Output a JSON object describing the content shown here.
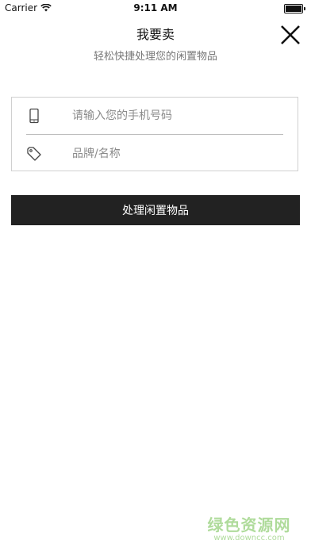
{
  "status_bar": {
    "carrier": "Carrier",
    "time": "9:11 AM"
  },
  "header": {
    "title": "我要卖",
    "subtitle": "轻松快捷处理您的闲置物品",
    "close_icon": "close-x-icon"
  },
  "form": {
    "phone": {
      "placeholder": "请输入您的手机号码",
      "value": "",
      "icon": "phone-icon"
    },
    "brand": {
      "placeholder": "品牌/名称",
      "value": "",
      "icon": "tag-icon"
    }
  },
  "submit_button": {
    "label": "处理闲置物品"
  },
  "watermark": {
    "text": "绿色资源网",
    "url": "www.downcc.com"
  },
  "colors": {
    "button_bg": "#222222",
    "watermark": "#6fbf4b"
  }
}
